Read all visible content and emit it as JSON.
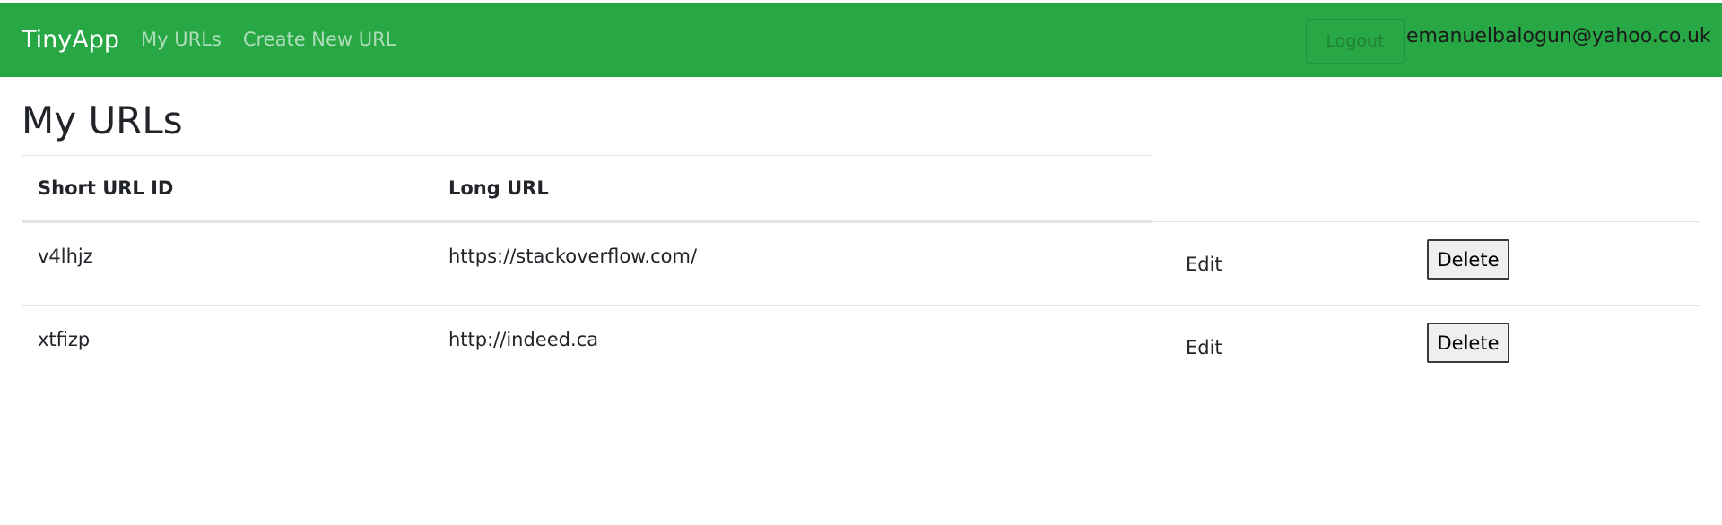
{
  "navbar": {
    "brand": "TinyApp",
    "links": [
      "My URLs",
      "Create New URL"
    ],
    "logout_label": "Logout",
    "user_email": "emanuelbalogun@yahoo.co.uk",
    "color": "#28a745"
  },
  "main": {
    "title": "My URLs",
    "table": {
      "headers": [
        "Short URL ID",
        "Long URL"
      ],
      "rows": [
        {
          "short_id": "v4lhjz",
          "long_url": "https://stackoverflow.com/",
          "edit_label": "Edit",
          "delete_label": "Delete"
        },
        {
          "short_id": "xtfizp",
          "long_url": "http://indeed.ca",
          "edit_label": "Edit",
          "delete_label": "Delete"
        }
      ]
    }
  }
}
